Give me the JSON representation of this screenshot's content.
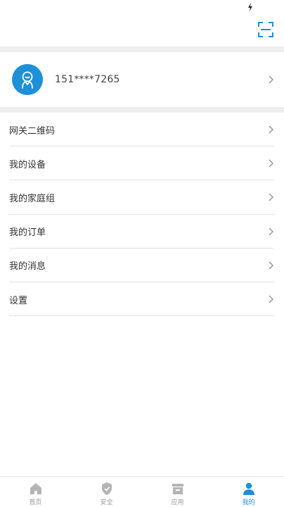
{
  "profile": {
    "phone": "151****7265"
  },
  "menu": [
    {
      "label": "网关二维码"
    },
    {
      "label": "我的设备"
    },
    {
      "label": "我的家庭组"
    },
    {
      "label": "我的订单"
    },
    {
      "label": "我的消息"
    },
    {
      "label": "设置"
    }
  ],
  "tabs": [
    {
      "label": "首页",
      "icon": "home-icon"
    },
    {
      "label": "安全",
      "icon": "shield-icon"
    },
    {
      "label": "应用",
      "icon": "apps-icon"
    },
    {
      "label": "我的",
      "icon": "person-icon",
      "active": true
    }
  ],
  "colors": {
    "accent": "#1e90d8",
    "inactive": "#9a9a9a"
  }
}
